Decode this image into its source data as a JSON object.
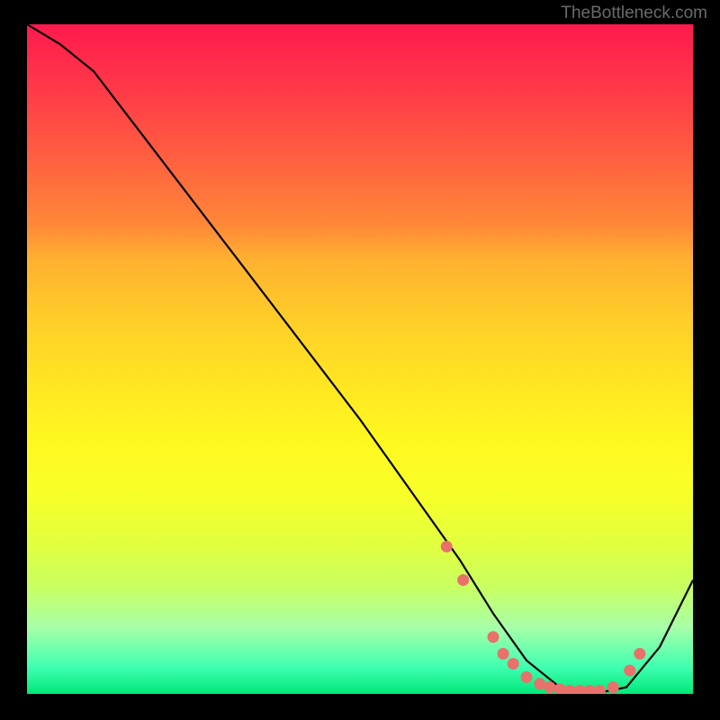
{
  "watermark": "TheBottleneck.com",
  "chart_data": {
    "type": "line",
    "title": "",
    "xlabel": "",
    "ylabel": "",
    "xlim": [
      0,
      100
    ],
    "ylim": [
      0,
      100
    ],
    "series": [
      {
        "name": "curve",
        "x": [
          0,
          5,
          10,
          20,
          30,
          40,
          50,
          60,
          65,
          70,
          75,
          80,
          85,
          90,
          95,
          100
        ],
        "y": [
          100,
          97,
          93,
          80,
          67,
          54,
          41,
          27,
          20,
          12,
          5,
          1,
          0,
          1,
          7,
          17
        ]
      }
    ],
    "markers": {
      "name": "dots",
      "x": [
        63,
        65.5,
        70,
        71.5,
        73,
        75,
        77,
        78.5,
        80,
        81.5,
        83,
        84.5,
        86,
        88,
        90.5,
        92
      ],
      "y": [
        22,
        17,
        8.5,
        6,
        4.5,
        2.5,
        1.5,
        1,
        0.7,
        0.5,
        0.5,
        0.5,
        0.5,
        1,
        3.5,
        6
      ]
    },
    "background_gradient": {
      "top": "#ff1a4e",
      "mid": "#fff820",
      "bottom": "#00e878"
    }
  }
}
